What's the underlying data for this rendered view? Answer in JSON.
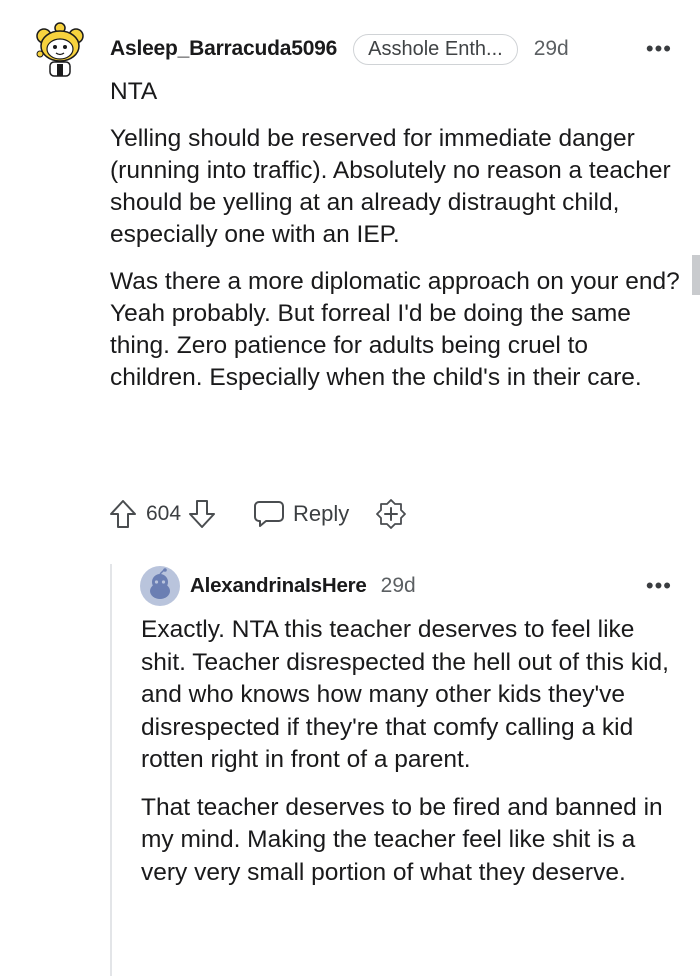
{
  "comment": {
    "username": "Asleep_Barracuda5096",
    "flair": "Asshole Enth...",
    "time": "29d",
    "more_label": "•••",
    "paragraphs": [
      "NTA",
      "Yelling should be reserved for immediate danger (running into traffic). Absolutely no reason a teacher should be yelling at an already distraught child, especially one with an IEP.",
      "Was there a more diplomatic approach on your end? Yeah probably. But forreal I'd be doing the same thing. Zero patience for adults being cruel to children. Especially when the child's in their care."
    ],
    "score": "604",
    "reply_label": "Reply",
    "icons": {
      "upvote": "upvote-arrow-icon",
      "downvote": "downvote-arrow-icon",
      "reply": "speech-bubble-icon",
      "award": "award-plus-icon",
      "avatar": "snoo-avatar-icon"
    }
  },
  "reply": {
    "username": "AlexandrinaIsHere",
    "time": "29d",
    "more_label": "•••",
    "paragraphs": [
      "Exactly. NTA this teacher deserves to feel like shit. Teacher disrespected the hell out of this kid, and who knows how many other kids they've disrespected if they're that comfy calling a kid rotten right in front of a parent.",
      "That teacher deserves to be fired and banned in my mind. Making the teacher feel like shit is a very very small portion of what they deserve."
    ],
    "icons": {
      "avatar": "default-snoo-avatar-icon"
    }
  },
  "colors": {
    "text": "#1a1a1b",
    "meta": "#5b5f62",
    "thread_line": "#e3e5e8",
    "avatar_bg": "#b9c4dc",
    "avatar_accent": "#6b7fb3",
    "snoo_yellow": "#f7d23e"
  }
}
